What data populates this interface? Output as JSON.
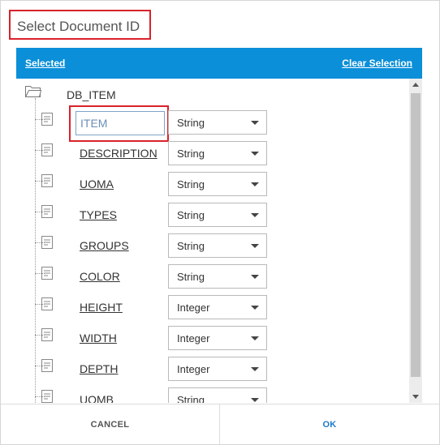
{
  "dialog": {
    "title": "Select Document ID"
  },
  "panel": {
    "selected_label": "Selected",
    "clear_label": "Clear Selection"
  },
  "tree": {
    "root_label": "DB_ITEM",
    "fields": [
      {
        "name": "ITEM",
        "type": "String",
        "editing": true
      },
      {
        "name": "DESCRIPTION",
        "type": "String"
      },
      {
        "name": "UOMA",
        "type": "String"
      },
      {
        "name": "TYPES",
        "type": "String"
      },
      {
        "name": "GROUPS",
        "type": "String"
      },
      {
        "name": "COLOR",
        "type": "String"
      },
      {
        "name": "HEIGHT",
        "type": "Integer"
      },
      {
        "name": "WIDTH",
        "type": "Integer"
      },
      {
        "name": "DEPTH",
        "type": "Integer"
      },
      {
        "name": "UOMB",
        "type": "String"
      }
    ]
  },
  "footer": {
    "cancel_label": "CANCEL",
    "ok_label": "OK"
  },
  "colors": {
    "header_bg": "#0b8fd8",
    "highlight_border": "#d9222a",
    "ok_text": "#1f7ac8"
  },
  "icons": {
    "folder": "folder-icon",
    "document": "document-icon",
    "dropdown": "chevron-down-icon"
  }
}
